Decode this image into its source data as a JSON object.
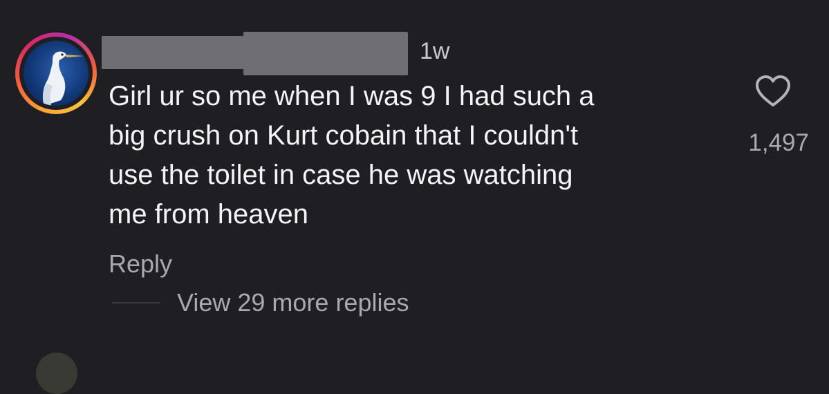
{
  "comment": {
    "timestamp": "1w",
    "text": "Girl ur so me when I was 9 I had such a\nbig crush on Kurt cobain that I couldn't\nuse the toilet in case he was watching\nme from heaven",
    "like_count": "1,497",
    "reply_label": "Reply",
    "view_replies_label": "View 29 more replies",
    "avatar_icon": "egret-avatar",
    "like_icon": "heart-outline-icon"
  },
  "colors": {
    "background": "#1f1f23",
    "text": "#f4f4f6",
    "muted": "#a9a9b0",
    "redaction": "#6f6f73"
  }
}
